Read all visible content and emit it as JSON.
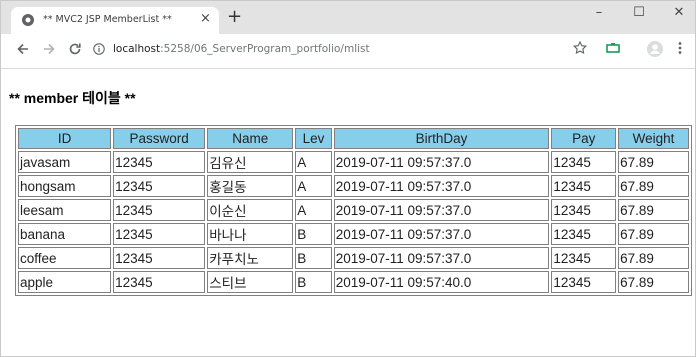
{
  "browser": {
    "tab_title": "** MVC2 JSP MemberList **",
    "tab_close": "×",
    "new_tab": "+",
    "window_minimize": "–",
    "window_maximize": "☐",
    "window_close": "✕",
    "url_host": "localhost",
    "url_path": ":5258/06_ServerProgram_portfolio/mlist",
    "icons": [
      "globe-icon",
      "close-icon",
      "plus-icon",
      "back-icon",
      "forward-icon",
      "reload-icon",
      "info-icon",
      "star-icon",
      "extension-icon",
      "profile-icon",
      "menu-icon"
    ]
  },
  "page": {
    "heading": "** member 테이블 **"
  },
  "table": {
    "headers": [
      "ID",
      "Password",
      "Name",
      "Lev",
      "BirthDay",
      "Pay",
      "Weight"
    ],
    "rows": [
      [
        "javasam",
        "12345",
        "김유신",
        "A",
        "2019-07-11 09:57:37.0",
        "12345",
        "67.89"
      ],
      [
        "hongsam",
        "12345",
        "홍길동",
        "A",
        "2019-07-11 09:57:37.0",
        "12345",
        "67.89"
      ],
      [
        "leesam",
        "12345",
        "이순신",
        "A",
        "2019-07-11 09:57:37.0",
        "12345",
        "67.89"
      ],
      [
        "banana",
        "12345",
        "바나나",
        "B",
        "2019-07-11 09:57:37.0",
        "12345",
        "67.89"
      ],
      [
        "coffee",
        "12345",
        "카푸치노",
        "B",
        "2019-07-11 09:57:37.0",
        "12345",
        "67.89"
      ],
      [
        "apple",
        "12345",
        "스티브",
        "B",
        "2019-07-11 09:57:40.0",
        "12345",
        "67.89"
      ]
    ]
  },
  "colors": {
    "header_bg": "#87ceeb",
    "tabstrip_bg": "#e3e3e3",
    "border": "#808080"
  }
}
